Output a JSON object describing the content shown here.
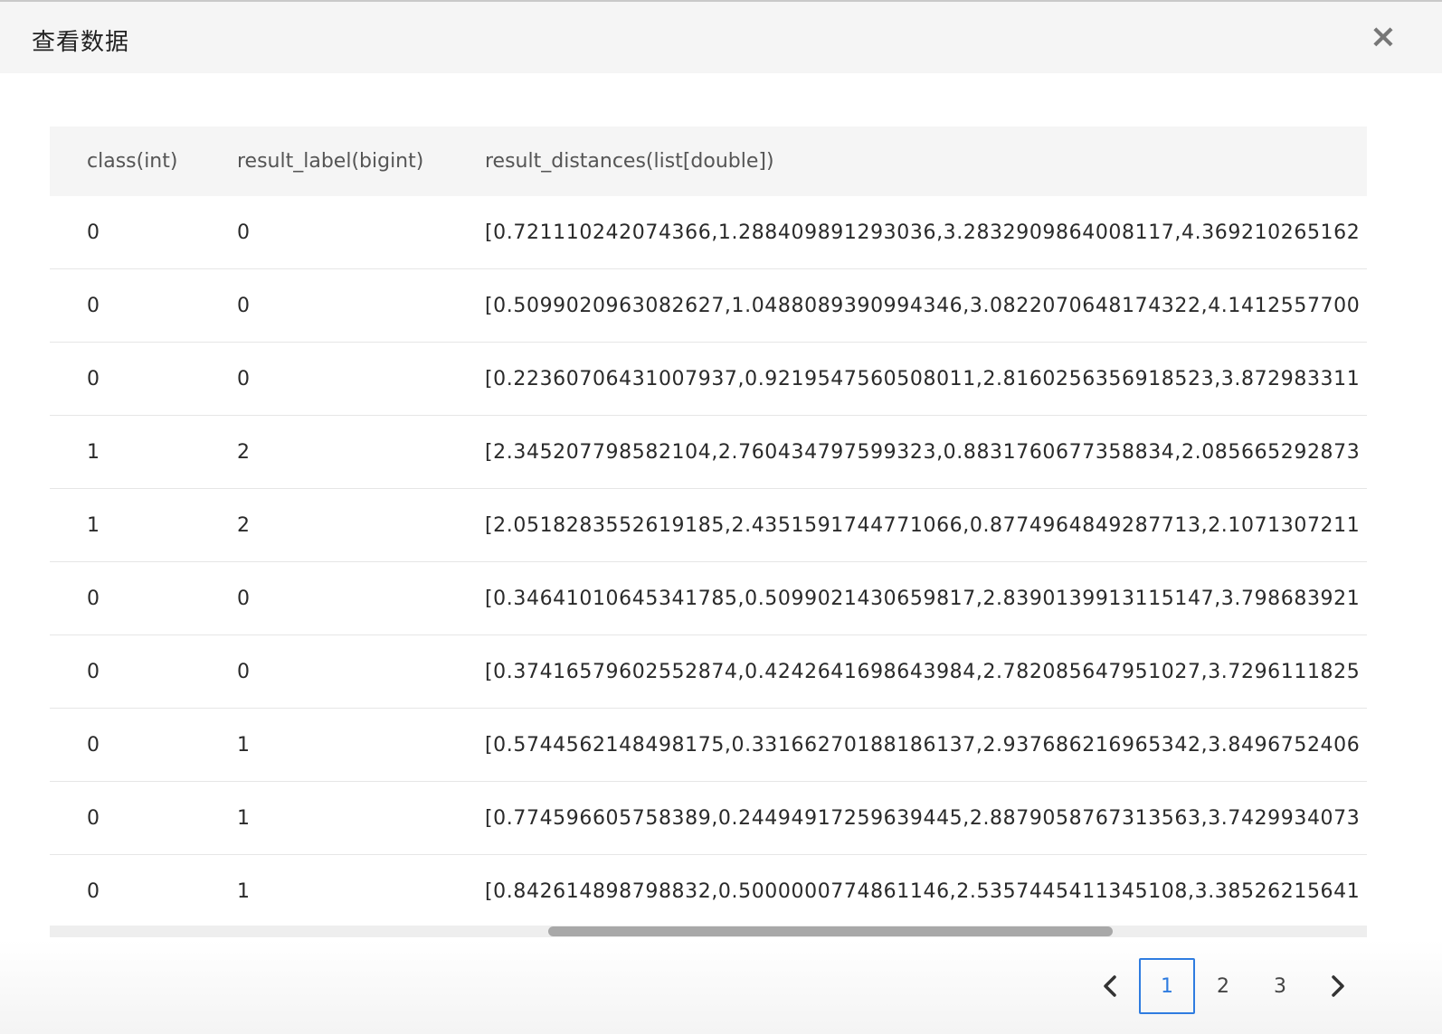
{
  "modal": {
    "title": "查看数据",
    "close_label": "×"
  },
  "table": {
    "columns": [
      {
        "label": "class(int)"
      },
      {
        "label": "result_label(bigint)"
      },
      {
        "label": "result_distances(list[double])"
      }
    ],
    "rows": [
      {
        "class": "0",
        "label": "0",
        "distances": "[0.721110242074366,1.288409891293036,3.2832909864008117,4.369210265162"
      },
      {
        "class": "0",
        "label": "0",
        "distances": "[0.5099020963082627,1.0488089390994346,3.0822070648174322,4.1412557700"
      },
      {
        "class": "0",
        "label": "0",
        "distances": "[0.22360706431007937,0.9219547560508011,2.8160256356918523,3.872983311"
      },
      {
        "class": "1",
        "label": "2",
        "distances": "[2.345207798582104,2.760434797599323,0.8831760677358834,2.085665292873"
      },
      {
        "class": "1",
        "label": "2",
        "distances": "[2.0518283552619185,2.4351591744771066,0.8774964849287713,2.1071307211"
      },
      {
        "class": "0",
        "label": "0",
        "distances": "[0.34641010645341785,0.5099021430659817,2.8390139913115147,3.798683921"
      },
      {
        "class": "0",
        "label": "0",
        "distances": "[0.37416579602552874,0.4242641698643984,2.782085647951027,3.7296111825"
      },
      {
        "class": "0",
        "label": "1",
        "distances": "[0.5744562148498175,0.33166270188186137,2.937686216965342,3.8496752406"
      },
      {
        "class": "0",
        "label": "1",
        "distances": "[0.774596605758389,0.24494917259639445,2.8879058767313563,3.7429934073"
      },
      {
        "class": "0",
        "label": "1",
        "distances": "[0.842614898798832,0.5000000774861146,2.5357445411345108,3.38526215641"
      }
    ]
  },
  "pagination": {
    "prev_icon": "chevron-left-icon",
    "next_icon": "chevron-right-icon",
    "pages": [
      "1",
      "2",
      "3"
    ],
    "current_page": "1",
    "accent_color": "#2f7ce0"
  }
}
